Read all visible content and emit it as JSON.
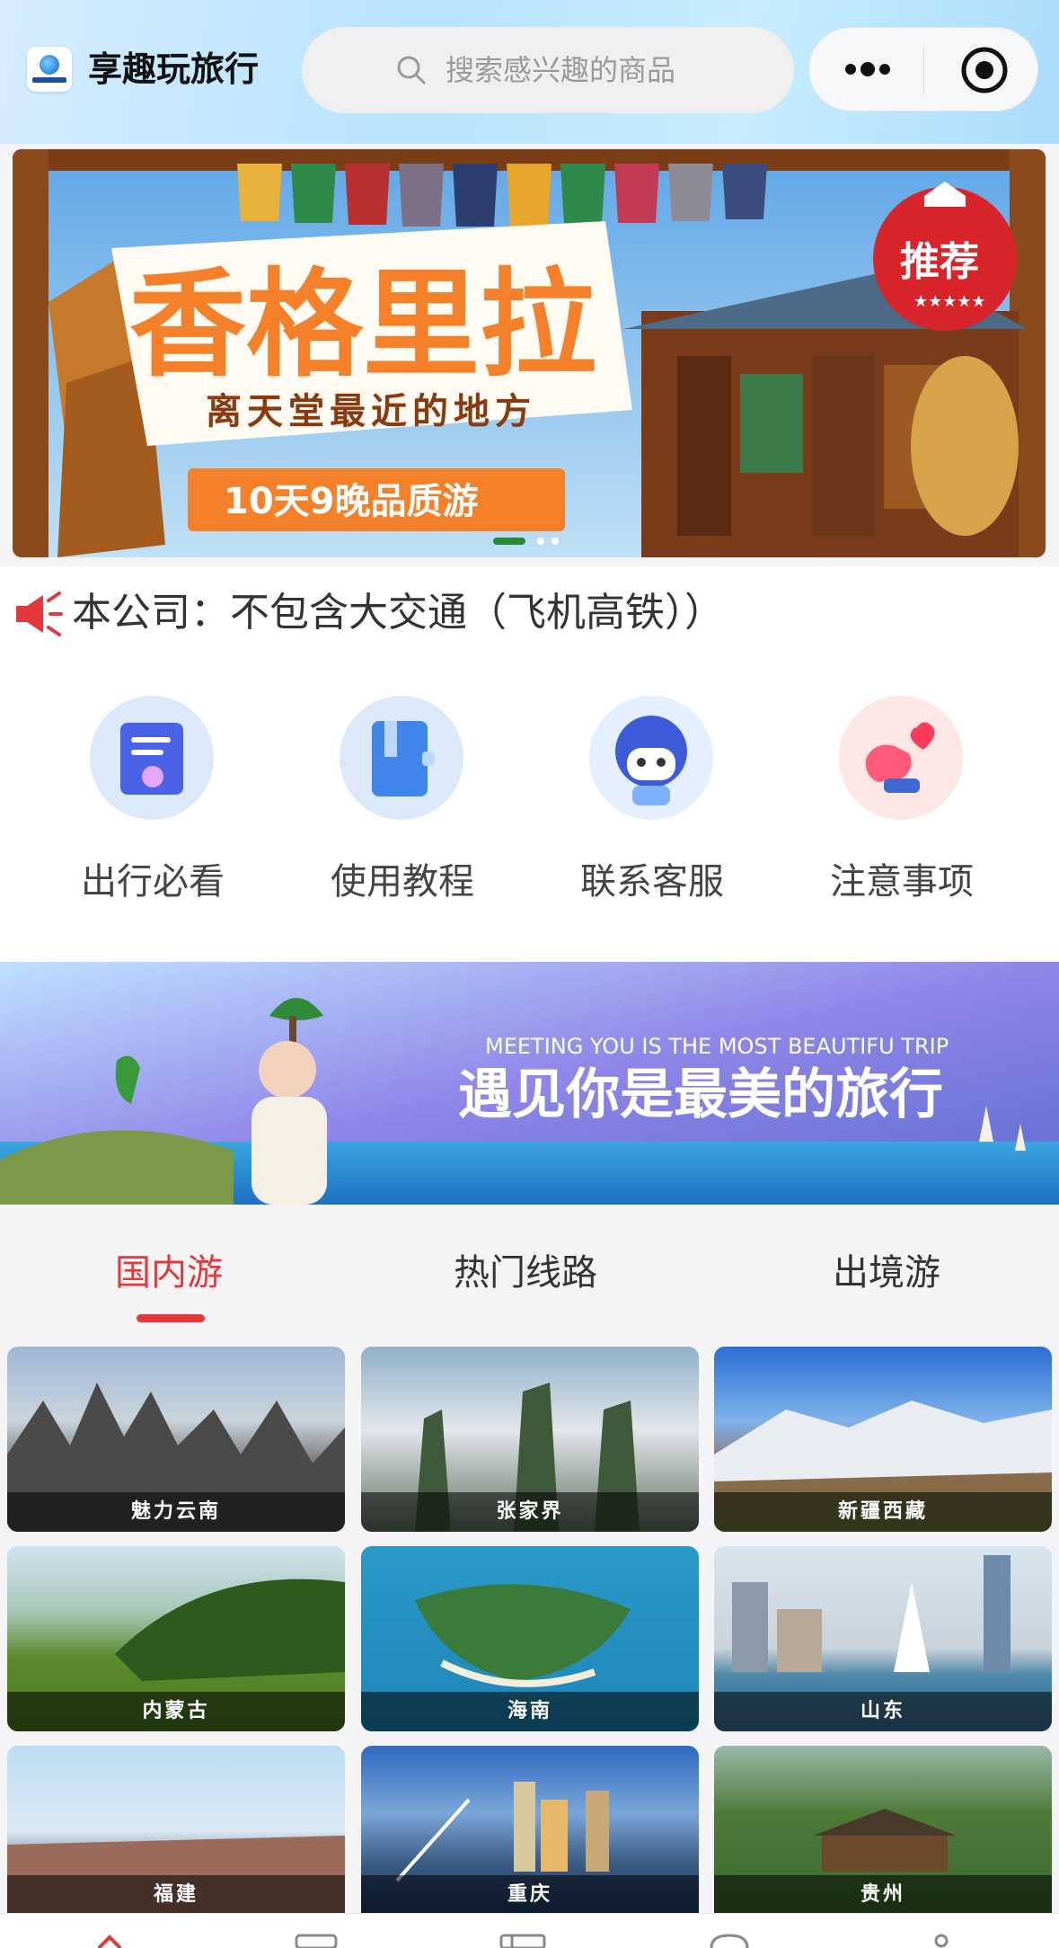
{
  "header": {
    "app_title": "享趣玩旅行",
    "search_placeholder": "搜索感兴趣的商品"
  },
  "banner": {
    "title": "香格里拉",
    "subtitle": "离天堂最近的地方",
    "tag": "10天9晚品质游",
    "badge": "推荐"
  },
  "notice": {
    "icon": "speaker-icon",
    "text": "本公司：不包含大交通（飞机高铁））"
  },
  "quick_links": [
    {
      "label": "出行必看",
      "icon": "document-check-icon"
    },
    {
      "label": "使用教程",
      "icon": "book-icon"
    },
    {
      "label": "联系客服",
      "icon": "robot-support-icon"
    },
    {
      "label": "注意事项",
      "icon": "hand-heart-icon"
    }
  ],
  "promo_banner": {
    "en": "MEETING YOU IS THE MOST BEAUTIFU TRIP",
    "cn": "遇见你是最美的旅行"
  },
  "tabs": [
    {
      "label": "国内游",
      "active": true
    },
    {
      "label": "热门线路",
      "active": false
    },
    {
      "label": "出境游",
      "active": false
    }
  ],
  "destinations": [
    {
      "name": "魅力云南"
    },
    {
      "name": "张家界"
    },
    {
      "name": "新疆西藏"
    },
    {
      "name": "内蒙古"
    },
    {
      "name": "海南"
    },
    {
      "name": "山东"
    },
    {
      "name": "福建"
    },
    {
      "name": "重庆"
    },
    {
      "name": "贵州"
    }
  ],
  "colors": {
    "accent": "#e4393c",
    "banner_orange": "#f5802a",
    "header_blue": "#b7e3fb"
  }
}
